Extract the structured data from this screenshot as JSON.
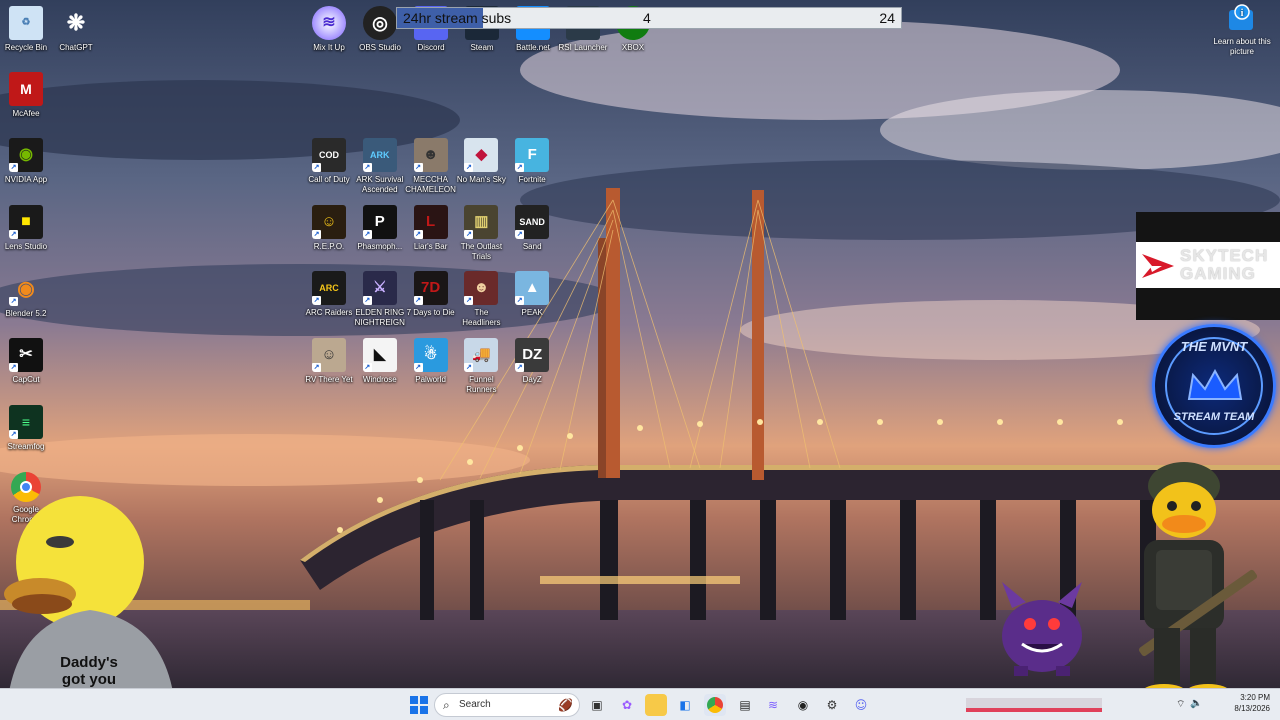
{
  "desktop": {
    "left_column": [
      {
        "label": "Recycle Bin",
        "icon": "recycle-bin-icon"
      },
      {
        "label": "McAfee",
        "icon": "mcafee-icon"
      },
      {
        "label": "NVIDIA App",
        "icon": "nvidia-icon"
      },
      {
        "label": "Lens Studio",
        "icon": "lens-studio-icon"
      },
      {
        "label": "Blender 5.2",
        "icon": "blender-icon"
      },
      {
        "label": "CapCut",
        "icon": "capcut-icon"
      },
      {
        "label": "Streamfog",
        "icon": "streamfog-icon"
      },
      {
        "label": "Google Chrome",
        "icon": "chrome-icon"
      }
    ],
    "chatgpt": {
      "label": "ChatGPT",
      "icon": "chatgpt-icon"
    },
    "top_row": [
      {
        "label": "Mix It Up",
        "icon": "mixitup-icon"
      },
      {
        "label": "OBS Studio",
        "icon": "obs-icon"
      },
      {
        "label": "Discord",
        "icon": "discord-icon"
      },
      {
        "label": "Steam",
        "icon": "steam-icon"
      },
      {
        "label": "Battle.net",
        "icon": "battlenet-icon"
      },
      {
        "label": "RSI Launcher",
        "icon": "rsi-icon"
      },
      {
        "label": "XBOX",
        "icon": "xbox-icon"
      }
    ],
    "games": [
      {
        "label": "Call of Duty",
        "icon": "call-of-duty-icon"
      },
      {
        "label": "ARK Survival Ascended",
        "icon": "ark-icon"
      },
      {
        "label": "MECCHA CHAMELEON",
        "icon": "meccha-chameleon-icon"
      },
      {
        "label": "No Man's Sky",
        "icon": "no-mans-sky-icon"
      },
      {
        "label": "Fortnite",
        "icon": "fortnite-icon"
      },
      {
        "label": "R.E.P.O.",
        "icon": "repo-icon"
      },
      {
        "label": "Phasmoph...",
        "icon": "phasmophobia-icon"
      },
      {
        "label": "Liar's Bar",
        "icon": "liars-bar-icon"
      },
      {
        "label": "The Outlast Trials",
        "icon": "outlast-trials-icon"
      },
      {
        "label": "Sand",
        "icon": "sand-icon"
      },
      {
        "label": "ARC Raiders",
        "icon": "arc-raiders-icon"
      },
      {
        "label": "ELDEN RING NIGHTREIGN",
        "icon": "elden-ring-icon"
      },
      {
        "label": "7 Days to Die",
        "icon": "7-days-icon"
      },
      {
        "label": "The Headliners",
        "icon": "headliners-icon"
      },
      {
        "label": "PEAK",
        "icon": "peak-icon"
      },
      {
        "label": "RV There Yet",
        "icon": "rv-there-yet-icon"
      },
      {
        "label": "Windrose",
        "icon": "windrose-icon"
      },
      {
        "label": "Palworld",
        "icon": "palworld-icon"
      },
      {
        "label": "Funnel Runners",
        "icon": "funnel-runners-icon"
      },
      {
        "label": "DayZ",
        "icon": "dayz-icon"
      }
    ],
    "learn_about": {
      "label": "Learn about this picture"
    }
  },
  "subgoal": {
    "title": "24hr stream subs",
    "current": "4",
    "goal": "24",
    "progress": 0.17
  },
  "skytech": {
    "line1": "SKYTECH",
    "line2": "GAMING"
  },
  "mvnt": {
    "top": "THE MVNT",
    "bottom": "STREAM TEAM"
  },
  "duck": {
    "shirt_line1": "Daddy's",
    "shirt_line2": "got you"
  },
  "taskbar": {
    "search_placeholder": "Search",
    "time": "3:20 PM",
    "date": "8/13/2026"
  },
  "colors": {
    "accent": "#3e5fa8",
    "taskbar": "#e8ecf2",
    "mvnt_blue": "#3a7bff",
    "skytech_red": "#d8192a"
  }
}
